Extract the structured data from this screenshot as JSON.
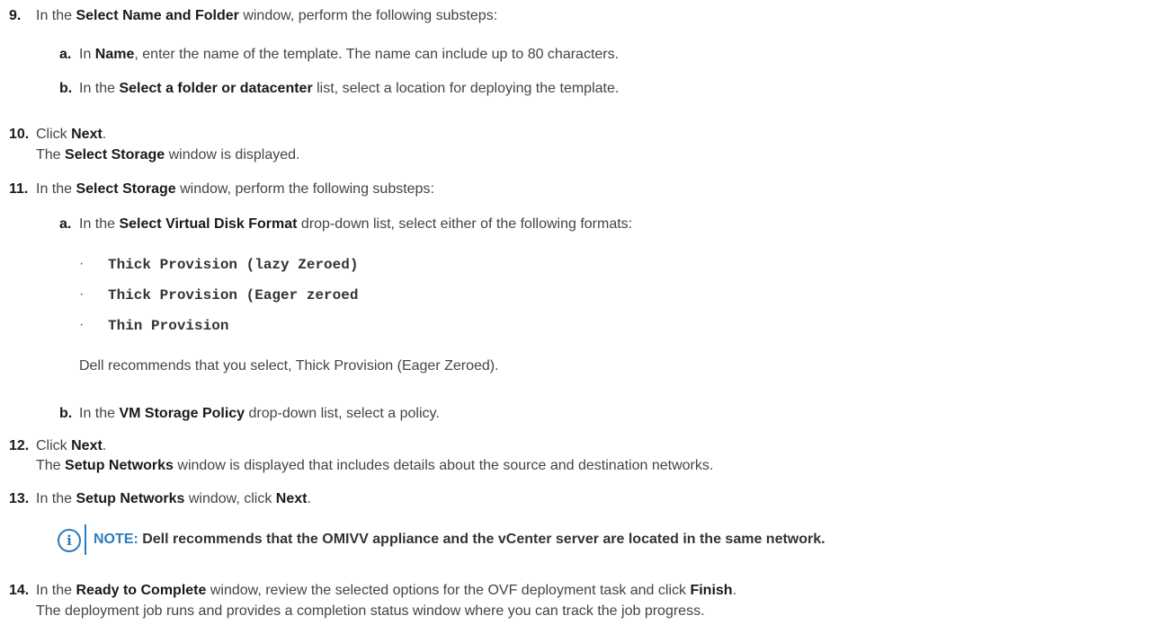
{
  "steps": [
    {
      "num": "9.",
      "parts": [
        [
          "In the ",
          false
        ],
        [
          "Select Name and Folder",
          true
        ],
        [
          " window, perform the following substeps:",
          false
        ]
      ]
    },
    {
      "num": "a.",
      "parts": [
        [
          "In ",
          false
        ],
        [
          "Name",
          true
        ],
        [
          ", enter the name of the template. The name can include up to 80 characters.",
          false
        ]
      ]
    },
    {
      "num": "b.",
      "parts": [
        [
          "In the ",
          false
        ],
        [
          "Select a folder or datacenter",
          true
        ],
        [
          " list, select a location for deploying the template.",
          false
        ]
      ]
    },
    {
      "num": "10.",
      "parts": [
        [
          "Click ",
          false
        ],
        [
          "Next",
          true
        ],
        [
          ".",
          false
        ]
      ]
    },
    {
      "num": "",
      "parts": [
        [
          "The ",
          false
        ],
        [
          "Select Storage",
          true
        ],
        [
          " window is displayed.",
          false
        ]
      ]
    },
    {
      "num": "11.",
      "parts": [
        [
          "In the ",
          false
        ],
        [
          "Select Storage",
          true
        ],
        [
          " window, perform the following substeps:",
          false
        ]
      ]
    },
    {
      "num": "a.",
      "parts": [
        [
          "In the ",
          false
        ],
        [
          "Select Virtual Disk Format",
          true
        ],
        [
          " drop-down list, select either of the following formats:",
          false
        ]
      ]
    },
    {
      "num": "",
      "parts": [
        [
          "Dell recommends that you select, Thick Provision (Eager Zeroed).",
          false
        ]
      ]
    },
    {
      "num": "b.",
      "parts": [
        [
          "In the ",
          false
        ],
        [
          "VM Storage Policy",
          true
        ],
        [
          " drop-down list, select a policy.",
          false
        ]
      ]
    },
    {
      "num": "12.",
      "parts": [
        [
          "Click ",
          false
        ],
        [
          "Next",
          true
        ],
        [
          ".",
          false
        ]
      ]
    },
    {
      "num": "",
      "parts": [
        [
          "The ",
          false
        ],
        [
          "Setup Networks",
          true
        ],
        [
          " window is displayed that includes details about the source and destination networks.",
          false
        ]
      ]
    },
    {
      "num": "13.",
      "parts": [
        [
          "In the ",
          false
        ],
        [
          "Setup Networks",
          true
        ],
        [
          " window, click ",
          false
        ],
        [
          "Next",
          true
        ],
        [
          ".",
          false
        ]
      ]
    },
    {
      "num": "14.",
      "parts": [
        [
          "In the ",
          false
        ],
        [
          "Ready to Complete",
          true
        ],
        [
          " window, review the selected options for the OVF deployment task and click ",
          false
        ],
        [
          "Finish",
          true
        ],
        [
          ".",
          false
        ]
      ]
    },
    {
      "num": "",
      "parts": [
        [
          "The deployment job runs and provides a completion status window where you can track the job progress.",
          false
        ]
      ]
    }
  ],
  "formats": [
    "Thick Provision (lazy Zeroed)",
    "Thick Provision (Eager zeroed",
    "Thin Provision"
  ],
  "bullet_char": "·",
  "note": {
    "icon": "i",
    "label": "NOTE:",
    "text": " Dell recommends that the OMIVV appliance and the vCenter server are located in the same network."
  },
  "colors": {
    "accent": "#2b7bbf",
    "text": "#444444",
    "bold": "#1a1a1a"
  }
}
